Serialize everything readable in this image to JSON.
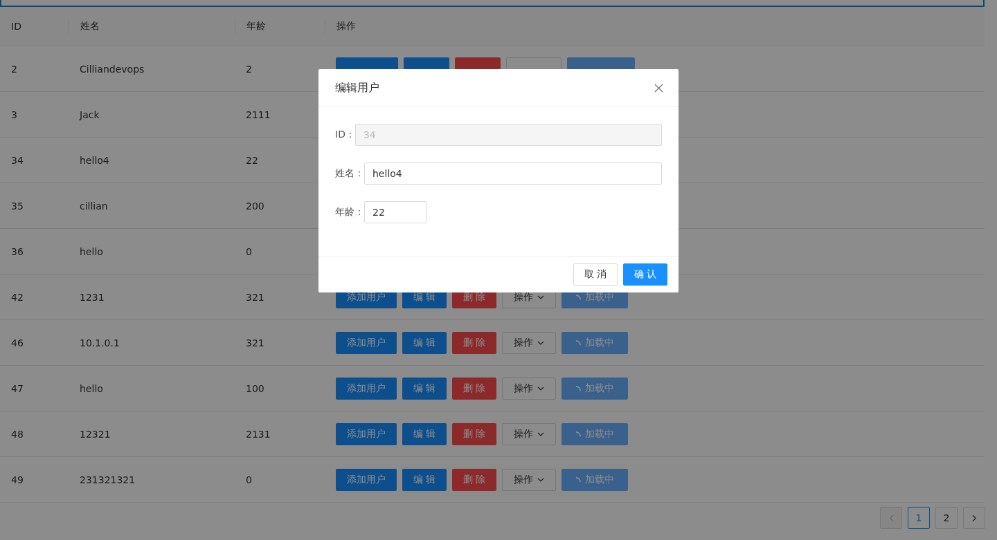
{
  "table": {
    "columns": [
      "ID",
      "姓名",
      "年龄",
      "操作"
    ],
    "rows": [
      {
        "id": "2",
        "name": "Cilliandevops",
        "age": "2",
        "actions_cut": true
      },
      {
        "id": "3",
        "name": "Jack",
        "age": "2111"
      },
      {
        "id": "34",
        "name": "hello4",
        "age": "22"
      },
      {
        "id": "35",
        "name": "cillian",
        "age": "200"
      },
      {
        "id": "36",
        "name": "hello",
        "age": "0"
      },
      {
        "id": "42",
        "name": "1231",
        "age": "321",
        "actions": [
          "添加用户",
          "编 辑",
          "删 除",
          "操作",
          "加载中"
        ]
      },
      {
        "id": "46",
        "name": "10.1.0.1",
        "age": "321",
        "actions": [
          "添加用户",
          "编 辑",
          "删 除",
          "操作",
          "加载中"
        ]
      },
      {
        "id": "47",
        "name": "hello",
        "age": "100",
        "actions": [
          "添加用户",
          "编 辑",
          "删 除",
          "操作",
          "加载中"
        ]
      },
      {
        "id": "48",
        "name": "12321",
        "age": "2131",
        "actions": [
          "添加用户",
          "编 辑",
          "删 除",
          "操作",
          "加载中"
        ]
      },
      {
        "id": "49",
        "name": "231321321",
        "age": "0",
        "actions": [
          "添加用户",
          "编 辑",
          "删 除",
          "操作",
          "加载中"
        ]
      }
    ]
  },
  "pagination": {
    "prev_disabled": true,
    "pages": [
      {
        "label": "1",
        "selected": true
      },
      {
        "label": "2",
        "selected": false
      }
    ]
  },
  "dialog": {
    "title": "编辑用户",
    "fields": [
      {
        "label": "ID：",
        "value": "34",
        "disabled": true,
        "kind": "wide"
      },
      {
        "label": "姓名：",
        "value": "hello4",
        "disabled": false,
        "kind": "wide"
      },
      {
        "label": "年龄：",
        "value": "22",
        "disabled": false,
        "kind": "short"
      }
    ],
    "buttons": [
      {
        "label": "取 消",
        "kind": "default"
      },
      {
        "label": "确 认",
        "kind": "primary"
      }
    ]
  }
}
